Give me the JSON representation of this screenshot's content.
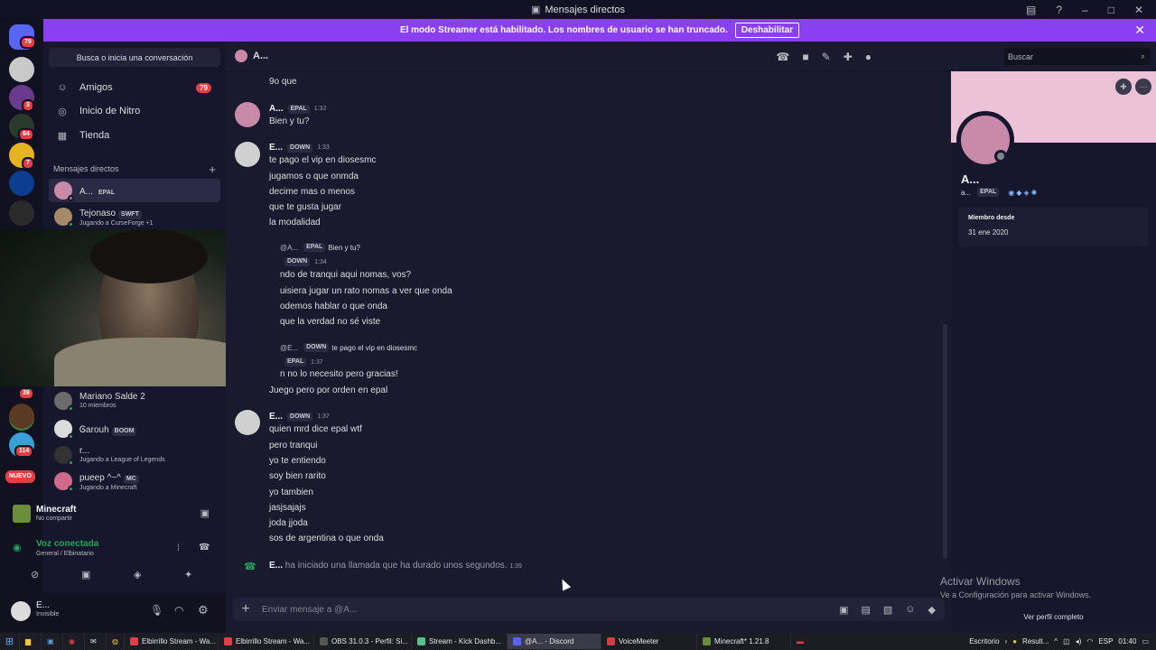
{
  "window": {
    "title": "Mensajes directos"
  },
  "banner": {
    "text": "El modo Streamer está habilitado. Los nombres de usuario se han truncado.",
    "button": "Deshabilitar"
  },
  "servers": {
    "badges": [
      "79",
      "3",
      "64",
      "7",
      "39",
      "114"
    ],
    "new_label": "NUEVO"
  },
  "sidebar": {
    "search_placeholder": "Busca o inicia una conversación",
    "nav": [
      {
        "label": "Amigos",
        "count": "79"
      },
      {
        "label": "Inicio de Nitro"
      },
      {
        "label": "Tienda"
      }
    ],
    "dm_header": "Mensajes directos",
    "dms_top": [
      {
        "name": "A...",
        "tag": "EPAL"
      },
      {
        "name": "Tejonaso",
        "tag": "SWFT",
        "status": "Jugando a CurseForge +1"
      }
    ],
    "dms_bottom": [
      {
        "name": "Mariano Salde 2",
        "status": "10 miembros"
      },
      {
        "name": "Ꮆarouh",
        "tag": "BOOM"
      },
      {
        "name": "r...",
        "status": "Jugando a League of Legends"
      },
      {
        "name": "pueep ^~^",
        "tag": "MC",
        "status": "Jugando a Minecraft"
      }
    ]
  },
  "activity": {
    "game": "Minecraft",
    "game_sub": "No compartir",
    "voice": "Voz conectada",
    "voice_sub": "General / Elbinatario"
  },
  "user": {
    "name": "E...",
    "status": "Invisible"
  },
  "chat": {
    "header_name": "A...",
    "search": "Buscar",
    "top_line": "9o que",
    "m1": {
      "name": "A...",
      "tag": "EPAL",
      "time": "1:32",
      "lines": [
        "Bien y tu?"
      ]
    },
    "m2": {
      "name": "E...",
      "tag": "DOWN",
      "time": "1:33",
      "lines": [
        "te pago el vip en diosesmc",
        "jugamos o que onmda",
        "decime mas o menos",
        "que te gusta jugar",
        "la modalidad"
      ]
    },
    "r1": {
      "who": "@A...",
      "tag": "EPAL",
      "text": "Bien y tu?"
    },
    "m3": {
      "tag": "DOWN",
      "time": "1:34",
      "lines": [
        "ndo de tranqui aqui nomas, vos?",
        "uisiera jugar un rato nomas a ver que onda",
        "odemos hablar o que onda",
        "que la verdad no sé viste"
      ]
    },
    "r2": {
      "who": "@E...",
      "tag": "DOWN",
      "text": "te pago el vip en diosesmc"
    },
    "m4": {
      "tag": "EPAL",
      "time": "1:37",
      "lines": [
        "n no lo necesito pero gracias!",
        "Juego pero por orden en epal"
      ]
    },
    "m5": {
      "name": "E...",
      "tag": "DOWN",
      "time": "1:37",
      "lines": [
        "quien mrd dice epal wtf",
        "pero tranqui",
        "yo te entiendo",
        "soy bien rarito",
        "yo tambien",
        "jasjsajajs",
        "joda jjoda",
        "sos de argentina o que onda"
      ]
    },
    "call": {
      "who": "E...",
      "text": "ha iniciado una llamada que ha durado unos segundos.",
      "time": "1:39"
    },
    "composer_placeholder": "Enviar mensaje a @A..."
  },
  "profile": {
    "name": "A...",
    "sub": "a...",
    "tag": "EPAL",
    "member_since_label": "Miembro desde",
    "member_since": "31 ene 2020",
    "full_profile": "Ver perfil completo"
  },
  "watermark": {
    "title": "Activar Windows",
    "sub": "Ve a Configuración para activar Windows."
  },
  "taskbar": {
    "items": [
      "Elbirrillo Stream - Wa...",
      "Elbirrillo Stream - Wa...",
      "OBS 31.0.3 - Perfil: Si...",
      "Stream - Kick Dashb...",
      "@A... - Discord",
      "VoiceMeeter",
      "Minecraft* 1.21.8"
    ],
    "escritorio": "Escritorio",
    "result": "Result...",
    "lang": "ESP",
    "clock": "01:40"
  }
}
